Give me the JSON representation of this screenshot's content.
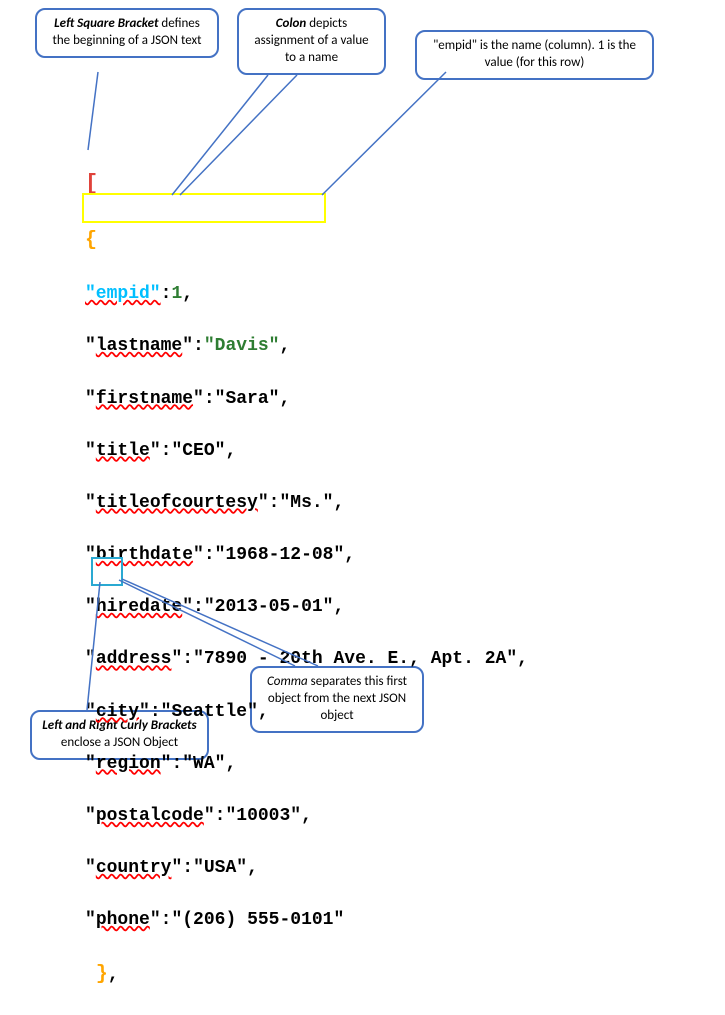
{
  "callouts": {
    "bracket": {
      "bold": "Left Square Bracket",
      "rest": " defines the beginning of a JSON text"
    },
    "colon": {
      "bold": "Colon",
      "rest": " depicts assignment of a value to a name"
    },
    "empid": {
      "text": "\"empid\" is the name (column). 1 is the value (for this row)"
    },
    "curly": {
      "bold": "Left and Right Curly Brackets",
      "rest": " enclose a JSON Object"
    },
    "comma": {
      "bold": "Comma",
      "rest": " separates this first object from the next JSON object"
    }
  },
  "code": {
    "open_bracket": "[",
    "open_brace": "{",
    "empid_key": "\"empid\"",
    "empid_colon": ":",
    "empid_val": "1",
    "empid_comma": ",",
    "lastname_key": "\"lastname\"",
    "lastname_val": "\"Davis\"",
    "firstname_key": "\"firstname\"",
    "firstname_val": "\"Sara\"",
    "title_key": "\"title\"",
    "title_val": "\"CEO\"",
    "toc_key": "\"titleofcourtesy\"",
    "toc_val": "\"Ms.\"",
    "bd_key": "\"birthdate\"",
    "bd_val": "\"1968-12-08\"",
    "hd_key": "\"hiredate\"",
    "hd_val": "\"2013-05-01\"",
    "addr_key": "\"address\"",
    "addr_val": "\"7890 - 20th Ave. E., Apt. 2A\"",
    "city_key": "\"city\"",
    "city_val": "\"Seattle\"",
    "region_key": "\"region\"",
    "region_val": "\"WA\"",
    "pc_key": "\"postalcode\"",
    "pc_val": "\"10003\"",
    "country_key": "\"country\"",
    "country_val": "\"USA\"",
    "phone_key": "\"phone\"",
    "phone_val": "\"(206) 555-0101\"",
    "close_brace": "}",
    "close_comma": ","
  }
}
